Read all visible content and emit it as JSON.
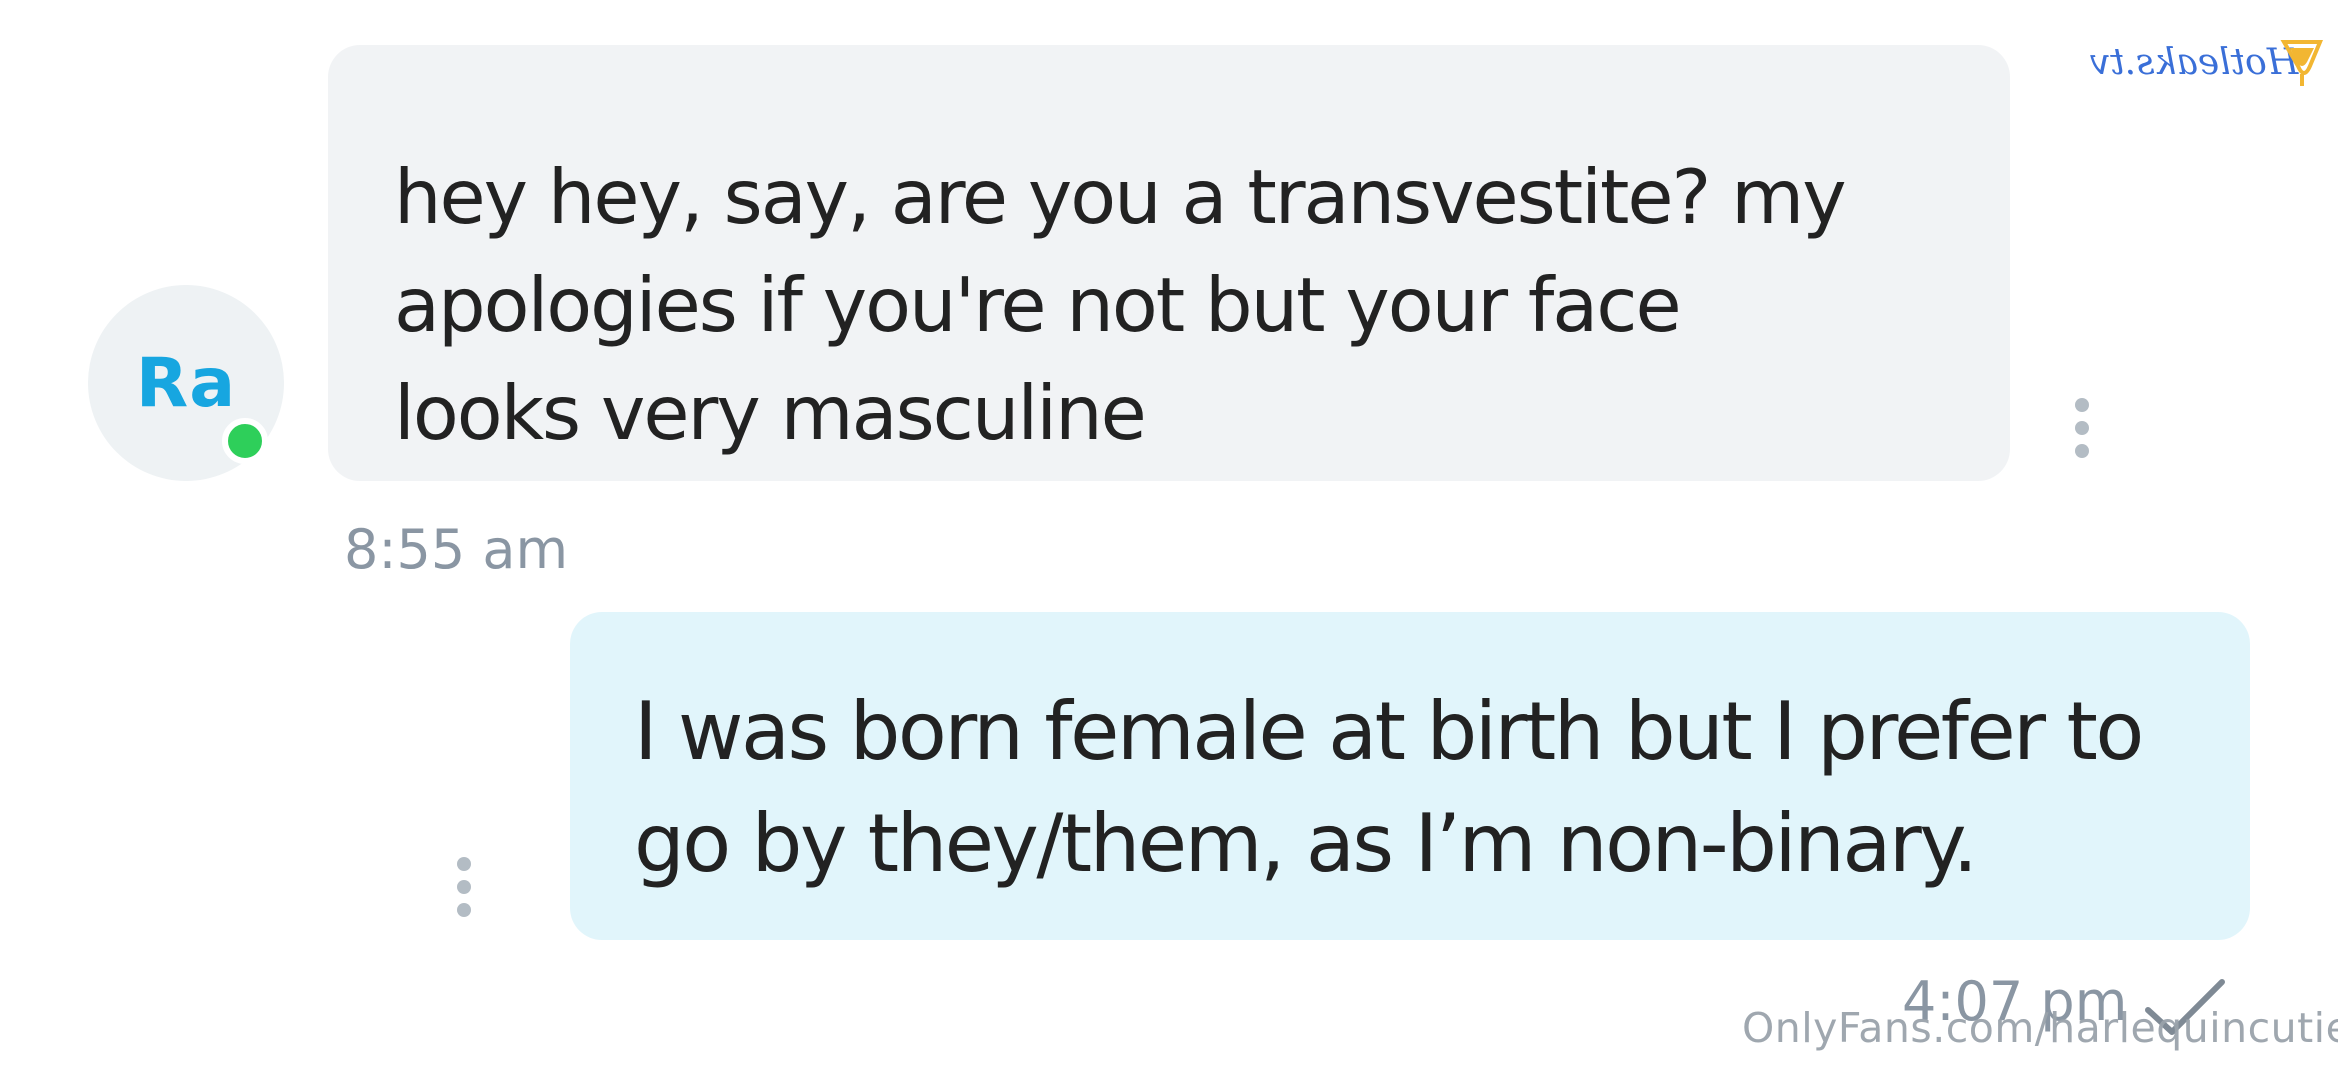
{
  "watermark_top": {
    "text": "Hotleaks.tv",
    "colors": {
      "text": "#3a6fd8",
      "logo": "#f2b632"
    }
  },
  "incoming_message": {
    "avatar_initials": "Ra",
    "online": true,
    "lines": [
      "hey hey, say, are you a transvestite? my",
      "apologies if you're not but your face",
      "looks very masculine"
    ],
    "time": "8:55 am",
    "more_icon": "more-vertical-icon"
  },
  "outgoing_message": {
    "lines": [
      "I was born female at birth but I prefer to",
      "go by they/them, as I’m non-binary."
    ],
    "time": "4:07 pm",
    "status_icon": "check-icon",
    "more_icon": "more-vertical-icon"
  },
  "watermark_bottom": "OnlyFans.com/harlequincutie",
  "colors": {
    "incoming_bubble": "#f1f3f5",
    "outgoing_bubble": "#e1f5fb",
    "avatar_bg": "#eef2f4",
    "avatar_text": "#17a6e0",
    "online_dot": "#2ecf5a",
    "timestamp": "#8a96a3",
    "message_text": "#222222"
  }
}
